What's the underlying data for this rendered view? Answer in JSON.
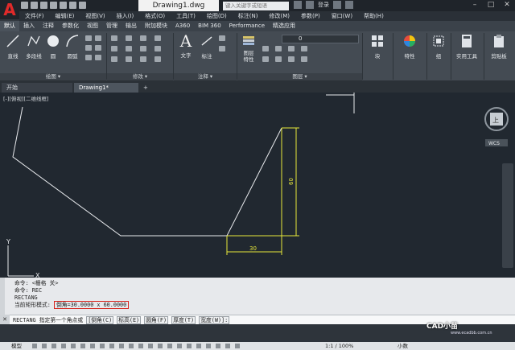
{
  "app": {
    "title": "Drawing1.dwg",
    "search_placeholder": "键入关键字或短语",
    "signin": "登录"
  },
  "menu": [
    "文件(F)",
    "编辑(E)",
    "视图(V)",
    "插入(I)",
    "格式(O)",
    "工具(T)",
    "绘图(D)",
    "标注(N)",
    "修改(M)",
    "参数(P)",
    "窗口(W)",
    "帮助(H)"
  ],
  "ribbon_tabs": [
    "默认",
    "插入",
    "注释",
    "参数化",
    "视图",
    "管理",
    "输出",
    "附加模块",
    "A360",
    "BIM 360",
    "Performance",
    "精选应用"
  ],
  "ribbon": {
    "draw_tools": [
      "直线",
      "多段线",
      "圆",
      "圆弧"
    ],
    "draw_panel": "绘图 ▾",
    "modify_panel": "修改 ▾",
    "text_tool": "文字",
    "dim_tool": "标注",
    "annot_panel": "注释 ▾",
    "layer_tool": "图层\n特性",
    "layer_value": "0",
    "layer_panel": "图层 ▾",
    "block": "块",
    "properties": "特性",
    "group": "组",
    "utilities": "实用工具",
    "clipboard": "剪贴板"
  },
  "file_tabs": [
    "开始",
    "Drawing1*"
  ],
  "viewport_label": "[-][俯视][二维线框]",
  "viewcube": {
    "top": "上",
    "wcs": "WCS"
  },
  "drawing": {
    "dim_horizontal": "30",
    "dim_vertical": "60",
    "ucs_y": "Y",
    "ucs_x": "X"
  },
  "command_history": [
    "命令: <栅格 关>",
    "命令: REC",
    "RECTANG",
    "当前矩形模式:"
  ],
  "current_mode": "倒角=30.0000 x 60.0000",
  "command_line": {
    "prefix": "RECTANG 指定第一个角点或",
    "options": [
      "[倒角(C)",
      "标高(E)",
      "圆角(F)",
      "厚度(T)",
      "宽度(W)]:"
    ]
  },
  "status": {
    "model": "模型",
    "scale": "1:1 / 100%",
    "decimal": "小数"
  },
  "watermark": {
    "name": "CAD小苗",
    "sub": "www.ecadbb.com.cn"
  },
  "colors": {
    "accent_red": "#d6231c",
    "dim_yellow": "#e8e83a",
    "canvas": "#212830"
  }
}
